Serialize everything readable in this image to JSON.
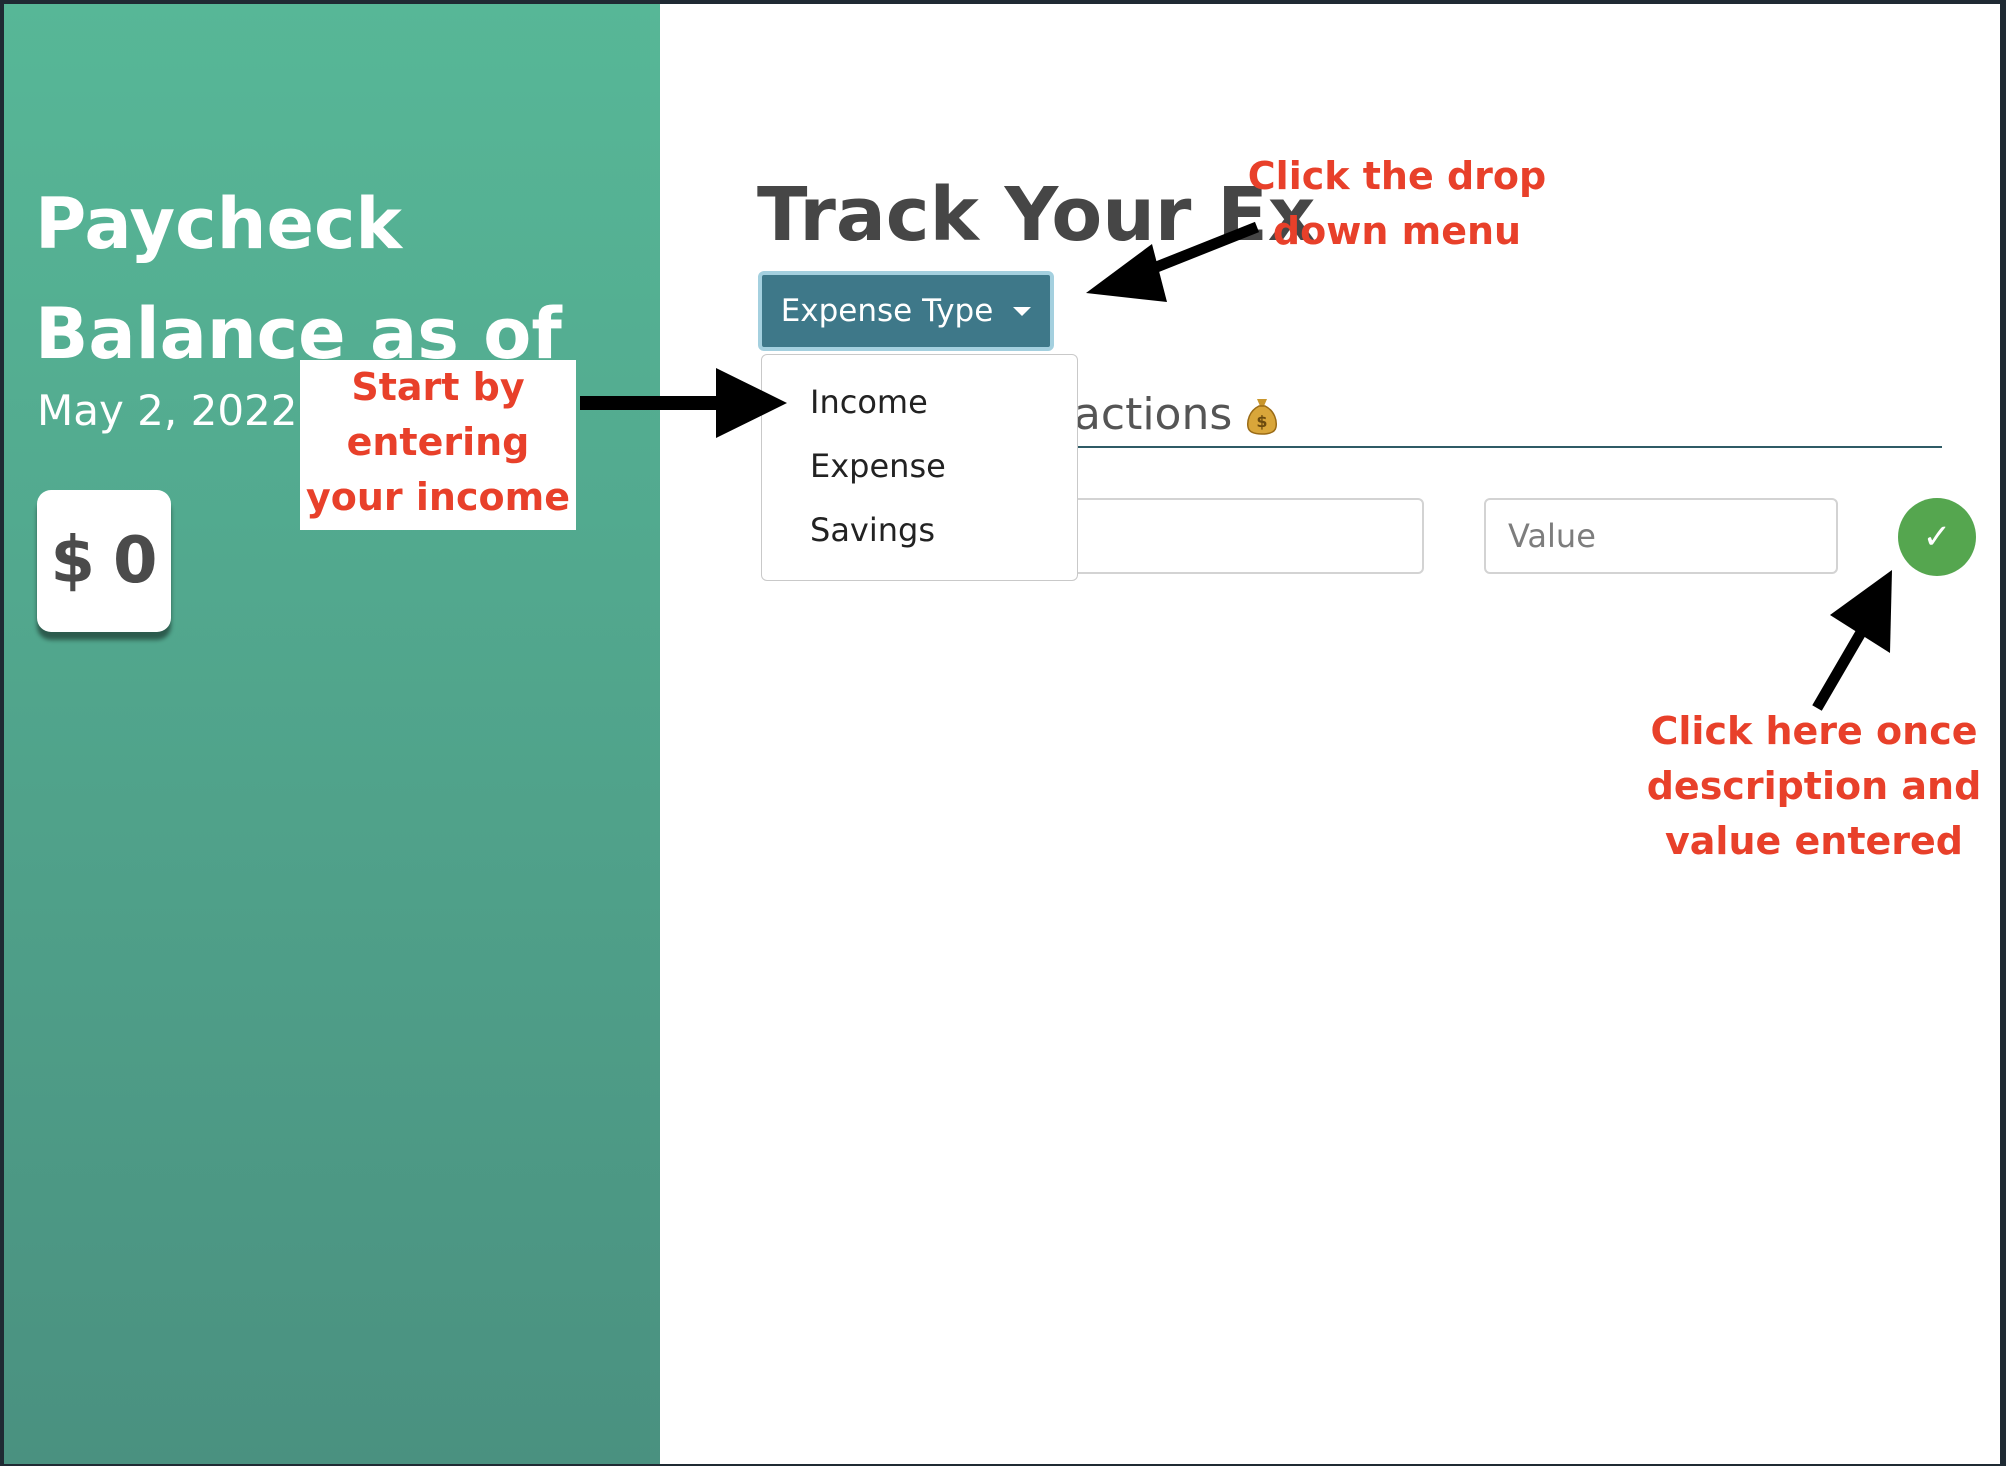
{
  "sidebar": {
    "title": "Paycheck Balance as of",
    "date": "May 2, 2022",
    "balance_currency": "$",
    "balance_value": "0"
  },
  "main": {
    "title": "Track Your Ex",
    "type_button_label": "Expense Type",
    "type_options": [
      "Income",
      "Expense",
      "Savings"
    ],
    "section_heading": "sactions",
    "section_icon": "money-bag-icon",
    "description_input": {
      "value": "",
      "placeholder": ""
    },
    "value_input": {
      "value": "",
      "placeholder": "Value"
    },
    "submit_label": "✓"
  },
  "annotations": {
    "dropdown_note": "Click the drop down menu",
    "income_note": "Start by entering your income",
    "submit_note": "Click here once description and value entered"
  },
  "colors": {
    "sidebar_top": "#57b797",
    "sidebar_bottom": "#4a9180",
    "button": "#3e7889",
    "submit": "#55a64f",
    "annotation_text": "#e8402a"
  }
}
